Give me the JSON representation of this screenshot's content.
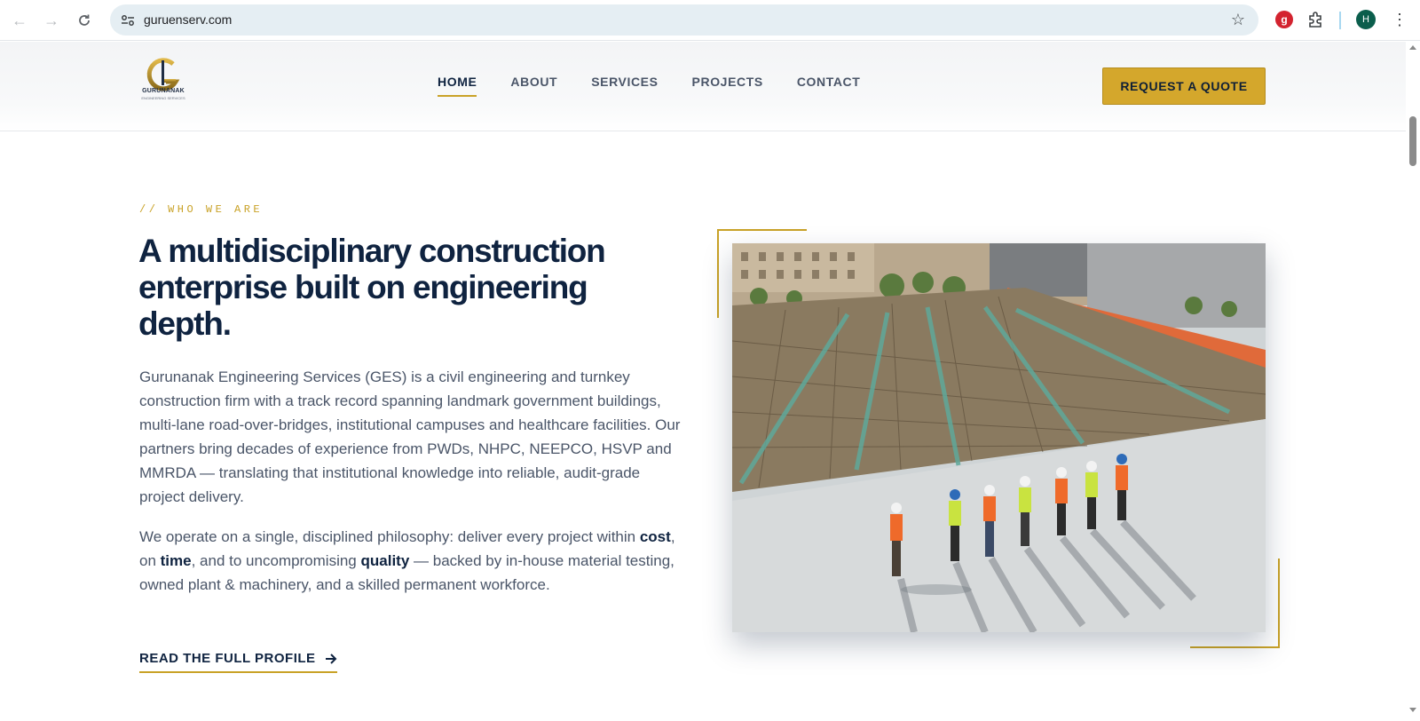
{
  "browser": {
    "url": "guruenserv.com",
    "profile_initial": "H",
    "extension_letter": "g"
  },
  "logo": {
    "name": "GURUNANAK",
    "tagline": "ENGINEERING SERVICES"
  },
  "nav": {
    "items": [
      {
        "label": "HOME",
        "active": true
      },
      {
        "label": "ABOUT",
        "active": false
      },
      {
        "label": "SERVICES",
        "active": false
      },
      {
        "label": "PROJECTS",
        "active": false
      },
      {
        "label": "CONTACT",
        "active": false
      }
    ],
    "cta": "REQUEST A QUOTE"
  },
  "about": {
    "eyebrow": "// WHO WE ARE",
    "headline": "A multidisciplinary construction enterprise built on engineering depth.",
    "paragraph1": "Gurunanak Engineering Services (GES) is a civil engineering and turnkey construction firm with a track record spanning landmark government buildings, multi-lane road-over-bridges, institutional campuses and healthcare facilities. Our partners bring decades of experience from PWDs, NHPC, NEEPCO, HSVP and MMRDA — translating that institutional knowledge into reliable, audit-grade project delivery.",
    "paragraph2": {
      "p1": "We operate on a single, disciplined philosophy: deliver every project within ",
      "b1": "cost",
      "p2": ", on ",
      "b2": "time",
      "p3": ", and to uncompromising ",
      "b3": "quality",
      "p4": " — backed by in-house material testing, owned plant & machinery, and a skilled permanent workforce."
    },
    "cta": "READ THE FULL PROFILE"
  },
  "colors": {
    "navy": "#0f2340",
    "gold": "#c9a227",
    "button_gold": "#d4a72c",
    "body_text": "#4a5568"
  }
}
